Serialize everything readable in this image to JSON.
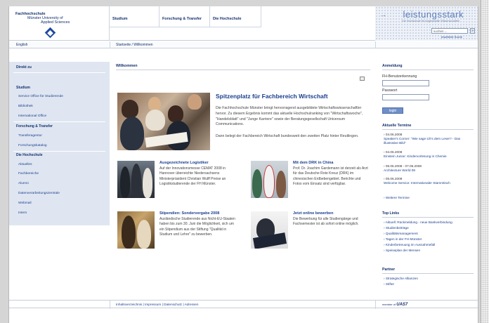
{
  "header": {
    "logo_line1": "Fachhochschule",
    "logo_line2": "Münster University of",
    "logo_line3": "Applied Sciences",
    "nav": [
      "Studium",
      "Forschung & Transfer",
      "Die Hochschule"
    ],
    "brand_title": "leistungsstark",
    "brand_sub": "Die Hochschule für Angewandte Wissenschaften",
    "search_value": "suchen ...",
    "search_button": "»",
    "advanced_search": "erweiterte Suche"
  },
  "subbar": {
    "language": "English",
    "breadcrumb": "Startseite / Willkommen"
  },
  "sidebar": {
    "heading": "Direkt zu",
    "groups": [
      {
        "title": "Studium",
        "items": [
          "Service Office für Studierende",
          "Bibliothek",
          "International Office"
        ]
      },
      {
        "title": "Forschung & Transfer",
        "items": [
          "Transferagentur",
          "Forschungskatalog"
        ]
      },
      {
        "title": "Die Hochschule",
        "items": [
          "Aktuelles",
          "Fachbereiche",
          "Alumni",
          "Datenverarbeitungszentrale",
          "Webmail",
          "Intern"
        ]
      }
    ]
  },
  "main": {
    "title": "Willkommen",
    "feature": {
      "heading": "Spitzenplatz für Fachbereich Wirtschaft",
      "text1": "Die Fachhochschule Münster bringt hervorragend ausgebildete Wirtschaftswissenschaftler hervor. Zu diesem Ergebnis kommt das aktuelle Hochschulranking von \"Wirtschaftswoche\", \"Handelsblatt\" und \"Junge Karriere\" sowie der Beratungsgesellschaft Universum Communications.",
      "text2": "Dann belegt der Fachbereich Wirtschaft bundesweit den zweiten Platz hinter Reutlingen."
    },
    "tiles": [
      {
        "heading": "Ausgezeichnete Logistiker",
        "text": "Auf der Innovationsmesse CEMAT 2008 in Hannover überreichte Niedersachsens Ministerpräsident Christian Wulff Preise an Logistikstudierende der FH Münster."
      },
      {
        "heading": "Mit dem DRK in China",
        "text": "Prof. Dr. Joachim Gardemann ist derzeit als Arzt für das Deutsche Rote Kreuz (DRK) im chinesischen Erdbebengebiet. Berichte und Fotos vom Einsatz sind verfügbar."
      },
      {
        "heading": "Stipendien: Sondervergabe 2008",
        "text": "Ausländische Studierende aus Nicht-EU-Staaten haben bis zum 30. Juni die Möglichkeit, sich um ein Stipendium aus der Stiftung \"Qualität in Studium und Lehre\" zu bewerben."
      },
      {
        "heading": "Jetzt online bewerben",
        "text": "Die Bewerbung für alle Studiengänge und Fachsemester ist ab sofort online möglich."
      }
    ]
  },
  "right": {
    "login_title": "Anmeldung",
    "user_label": "FH-Benutzerkennung",
    "pass_label": "Passwort",
    "login_button": "login",
    "dates_title": "Aktuelle Termine",
    "events": [
      {
        "date": "04.06.2008",
        "title": "Speaker's Corner: \"Wie sage ich's dem Leser? - Das illustrative Bild\""
      },
      {
        "date": "04.06.2008",
        "title": "Einstein Junior: Kindervorlesung in Chemie"
      },
      {
        "date": "05.06.2008 - 07.06.2008",
        "title": "Architecture World 08"
      },
      {
        "date": "05.06.2008",
        "title": "Welcome Service: Internationaler Stammtisch"
      }
    ],
    "more_dates": "Weitere Termine",
    "toplinks_title": "Top Links",
    "toplinks": [
      "Aktuell: Rückmeldung - neue Bankverbindung",
      "Studienbeiträge",
      "Qualitätsmanagement",
      "Tagen in der FH Münster",
      "Kinderbetreuung im Ausnahmefall",
      "Speiseplan der Mensen"
    ],
    "partner_title": "Partner",
    "partners": [
      "Strategische Allianzen",
      "Stifter"
    ]
  },
  "footer": {
    "links": "Inhaltsverzeichnis | Impressum | Datenschutz | Adressen",
    "member": "member of",
    "member_logo": "UAS7"
  }
}
